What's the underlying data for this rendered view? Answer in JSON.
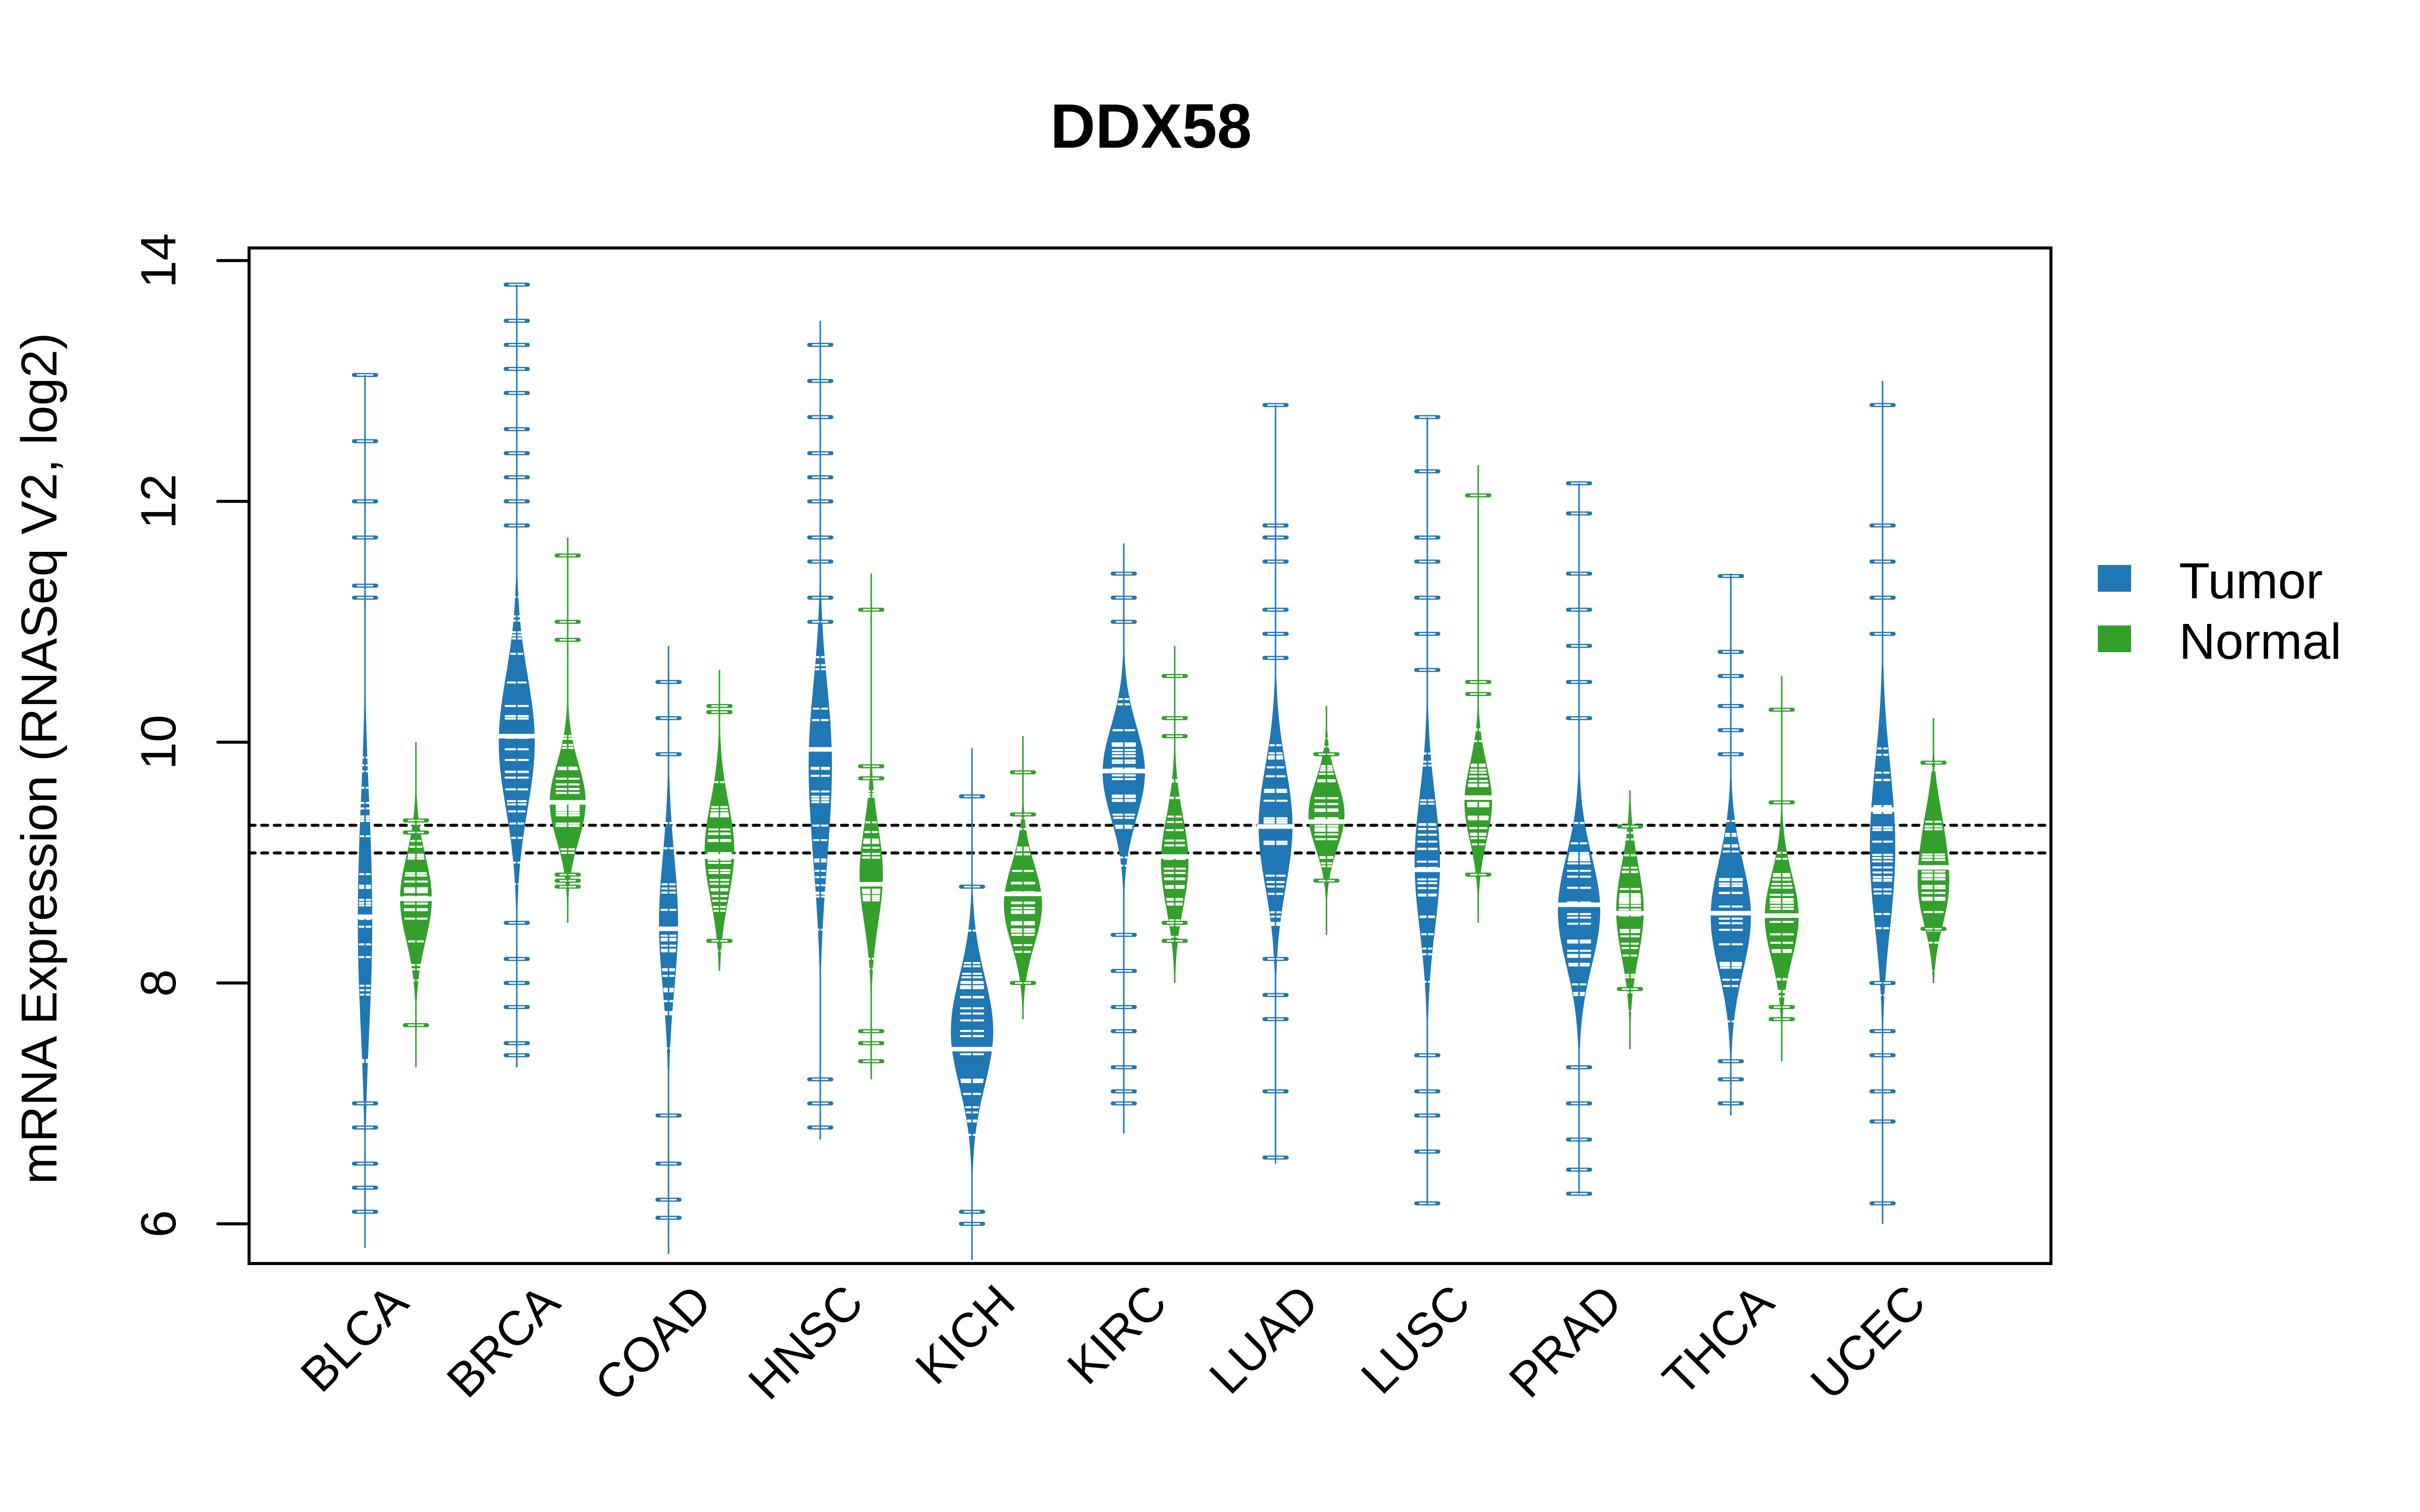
{
  "chart_data": {
    "type": "bean",
    "title": "DDX58",
    "xlabel": "",
    "ylabel": "mRNA Expression (RNASeq V2, log2)",
    "ylim": [
      5.67,
      14.1
    ],
    "yticks": [
      6,
      8,
      10,
      12,
      14
    ],
    "grid": false,
    "legend": {
      "placement": "right",
      "entries": [
        {
          "name": "Tumor",
          "color": "#1f77b4"
        },
        {
          "name": "Normal",
          "color": "#33a02c"
        }
      ]
    },
    "reference_lines": [
      {
        "value": 9.31,
        "style": "dotted"
      },
      {
        "value": 9.08,
        "style": "dotted"
      }
    ],
    "categories": [
      "BLCA",
      "BRCA",
      "COAD",
      "HNSC",
      "KICH",
      "KIRC",
      "LUAD",
      "LUSC",
      "PRAD",
      "THCA",
      "UCEC"
    ],
    "series": [
      {
        "name": "Tumor",
        "color": "#1f77b4",
        "beans": [
          {
            "min": 5.8,
            "max": 13.05,
            "median": 8.55,
            "components": [
              [
                8.3,
                0.75,
                1.0
              ],
              [
                9.3,
                0.6,
                0.4
              ]
            ],
            "peak": 0.34,
            "outliers": [
              13.05,
              12.5,
              12.0,
              11.7,
              11.3,
              11.2,
              6.1,
              6.3,
              6.5,
              6.8,
              7.0
            ]
          },
          {
            "min": 7.3,
            "max": 13.8,
            "median": 10.05,
            "components": [
              [
                10.0,
                0.55,
                1.0
              ]
            ],
            "peak": 0.85,
            "outliers": [
              13.8,
              13.5,
              13.3,
              13.1,
              12.9,
              12.6,
              12.4,
              12.2,
              12.0,
              11.8,
              8.5,
              8.2,
              8.0,
              7.8,
              7.5,
              7.4
            ]
          },
          {
            "min": 5.75,
            "max": 10.8,
            "median": 8.45,
            "components": [
              [
                8.5,
                0.55,
                1.0
              ]
            ],
            "peak": 0.45,
            "outliers": [
              10.5,
              10.2,
              9.9,
              6.9,
              6.5,
              6.2,
              6.05
            ]
          },
          {
            "min": 6.7,
            "max": 13.5,
            "median": 9.94,
            "components": [
              [
                9.9,
                0.6,
                1.0
              ],
              [
                9.0,
                0.5,
                0.3
              ]
            ],
            "peak": 0.55,
            "outliers": [
              13.3,
              13.0,
              12.7,
              12.4,
              12.2,
              12.0,
              11.7,
              11.5,
              11.2,
              11.0,
              7.2,
              7.0,
              6.8
            ]
          },
          {
            "min": 5.7,
            "max": 9.95,
            "median": 7.45,
            "components": [
              [
                7.6,
                0.45,
                1.0
              ]
            ],
            "peak": 1.0,
            "outliers": [
              9.55,
              8.8,
              6.0,
              6.1
            ]
          },
          {
            "min": 6.75,
            "max": 11.65,
            "median": 9.76,
            "components": [
              [
                9.75,
                0.38,
                1.0
              ]
            ],
            "peak": 1.0,
            "outliers": [
              11.4,
              11.2,
              11.0,
              8.4,
              8.1,
              7.8,
              7.6,
              7.3,
              7.1,
              7.0
            ]
          },
          {
            "min": 6.5,
            "max": 12.8,
            "median": 9.3,
            "components": [
              [
                9.3,
                0.5,
                1.0
              ]
            ],
            "peak": 0.8,
            "outliers": [
              12.8,
              11.8,
              11.7,
              11.5,
              11.1,
              10.9,
              10.7,
              8.2,
              7.9,
              7.7,
              7.1,
              6.55
            ]
          },
          {
            "min": 6.15,
            "max": 12.7,
            "median": 8.94,
            "components": [
              [
                9.0,
                0.55,
                1.0
              ]
            ],
            "peak": 0.6,
            "outliers": [
              12.7,
              12.25,
              11.7,
              11.5,
              11.2,
              10.9,
              10.6,
              7.4,
              7.1,
              6.9,
              6.6,
              6.17
            ]
          },
          {
            "min": 6.25,
            "max": 12.15,
            "median": 8.65,
            "components": [
              [
                8.6,
                0.45,
                1.0
              ]
            ],
            "peak": 1.0,
            "outliers": [
              12.15,
              11.9,
              11.4,
              11.1,
              10.8,
              10.5,
              10.2,
              7.3,
              7.0,
              6.7,
              6.45,
              6.25
            ]
          },
          {
            "min": 6.9,
            "max": 11.4,
            "median": 8.58,
            "components": [
              [
                8.55,
                0.45,
                1.0
              ]
            ],
            "peak": 0.95,
            "outliers": [
              11.38,
              10.75,
              10.55,
              10.3,
              10.1,
              9.9,
              7.35,
              7.2,
              7.0
            ]
          },
          {
            "min": 6.0,
            "max": 13.0,
            "median": 9.44,
            "components": [
              [
                9.3,
                0.6,
                1.0
              ],
              [
                8.7,
                0.5,
                0.4
              ]
            ],
            "peak": 0.6,
            "outliers": [
              12.8,
              11.8,
              11.5,
              11.2,
              10.9,
              8.0,
              7.6,
              7.4,
              7.1,
              6.85,
              6.17
            ]
          }
        ]
      },
      {
        "name": "Normal",
        "color": "#33a02c",
        "beans": [
          {
            "min": 7.3,
            "max": 10.0,
            "median": 8.7,
            "components": [
              [
                8.7,
                0.35,
                1.0
              ]
            ],
            "peak": 0.75,
            "outliers": [
              9.35,
              9.25,
              7.65
            ]
          },
          {
            "min": 8.5,
            "max": 11.7,
            "median": 9.5,
            "components": [
              [
                9.5,
                0.32,
                1.0
              ]
            ],
            "peak": 0.85,
            "outliers": [
              11.55,
              11.0,
              10.85,
              8.9,
              8.85,
              8.8
            ]
          },
          {
            "min": 8.1,
            "max": 10.6,
            "median": 9.05,
            "components": [
              [
                9.1,
                0.4,
                1.0
              ]
            ],
            "peak": 0.7,
            "outliers": [
              10.3,
              10.25,
              8.35
            ]
          },
          {
            "min": 7.2,
            "max": 11.4,
            "median": 8.82,
            "components": [
              [
                8.9,
                0.4,
                1.0
              ]
            ],
            "peak": 0.55,
            "outliers": [
              11.1,
              9.8,
              9.7,
              7.6,
              7.5,
              7.35
            ]
          },
          {
            "min": 7.7,
            "max": 10.05,
            "median": 8.74,
            "components": [
              [
                8.65,
                0.33,
                1.0
              ]
            ],
            "peak": 0.9,
            "outliers": [
              9.75,
              9.4,
              8.0
            ]
          },
          {
            "min": 8.0,
            "max": 10.8,
            "median": 9.05,
            "components": [
              [
                9.0,
                0.38,
                1.0
              ]
            ],
            "peak": 0.65,
            "outliers": [
              10.55,
              10.2,
              10.05,
              8.5,
              8.35
            ]
          },
          {
            "min": 8.4,
            "max": 10.3,
            "median": 9.34,
            "components": [
              [
                9.4,
                0.28,
                1.0
              ]
            ],
            "peak": 0.85,
            "outliers": [
              9.9,
              8.85
            ]
          },
          {
            "min": 8.5,
            "max": 12.3,
            "median": 9.54,
            "components": [
              [
                9.5,
                0.32,
                1.0
              ]
            ],
            "peak": 0.65,
            "outliers": [
              12.05,
              10.5,
              10.4,
              8.9
            ]
          },
          {
            "min": 7.45,
            "max": 9.6,
            "median": 8.58,
            "components": [
              [
                8.6,
                0.38,
                1.0
              ]
            ],
            "peak": 0.65,
            "outliers": [
              9.3,
              7.95
            ]
          },
          {
            "min": 7.35,
            "max": 10.55,
            "median": 8.56,
            "components": [
              [
                8.55,
                0.35,
                1.0
              ]
            ],
            "peak": 0.8,
            "outliers": [
              10.27,
              9.5,
              7.8,
              7.7
            ]
          },
          {
            "min": 8.0,
            "max": 10.2,
            "median": 8.96,
            "components": [
              [
                8.75,
                0.3,
                1.0
              ],
              [
                9.25,
                0.3,
                0.6
              ]
            ],
            "peak": 0.75,
            "outliers": [
              9.83,
              8.45
            ]
          }
        ]
      }
    ]
  }
}
